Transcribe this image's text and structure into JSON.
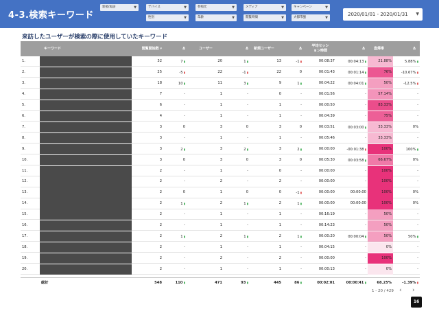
{
  "header": {
    "title": "4-3.検索キーワード",
    "filters": [
      "新規/再訪",
      "デバイス",
      "参照元",
      "メディア",
      "キャンペーン",
      "性別",
      "年齢",
      "閲覧時間",
      "大都市圏"
    ],
    "date_range": "2020/01/01 - 2020/01/31"
  },
  "section_title": "来訪したユーザーが検索の際に使用していたキーワード",
  "table": {
    "headers": {
      "keyword": "キーワード",
      "sessions": "閲覧開始数 ▾",
      "delta1": "Δ",
      "users": "ユーザー",
      "delta2": "Δ",
      "new_users": "新規ユーザー",
      "delta3": "Δ",
      "avg_session_line1": "平均セッシ",
      "avg_session_line2": "ョン時間",
      "delta4": "Δ",
      "bounce": "直帰率",
      "delta5": "Δ"
    },
    "rows": [
      {
        "num": "1.",
        "s": "32",
        "sd": "7",
        "sdir": "up",
        "u": "20",
        "ud": "1",
        "udir": "up",
        "n": "13",
        "nd": "-1",
        "ndir": "down",
        "t": "00:08:37",
        "td": "00:04:13",
        "tdir": "up",
        "b": "21.88%",
        "bd": "5.88%",
        "bdir": "up",
        "shade": 0.25
      },
      {
        "num": "2.",
        "s": "25",
        "sd": "-5",
        "sdir": "down",
        "u": "22",
        "ud": "-1",
        "udir": "down",
        "n": "22",
        "nd": "0",
        "ndir": "",
        "t": "00:01:43",
        "td": "00:01:14",
        "tdir": "up",
        "b": "76%",
        "bd": "-10.67%",
        "bdir": "down",
        "shade": 0.8
      },
      {
        "num": "3.",
        "s": "18",
        "sd": "10",
        "sdir": "up",
        "u": "11",
        "ud": "3",
        "udir": "up",
        "n": "9",
        "nd": "1",
        "ndir": "up",
        "t": "00:04:22",
        "td": "00:04:01",
        "tdir": "up",
        "b": "50%",
        "bd": "-12.5%",
        "bdir": "down",
        "shade": 0.4
      },
      {
        "num": "4.",
        "s": "7",
        "sd": "-",
        "sdir": "",
        "u": "1",
        "ud": "-",
        "udir": "",
        "n": "0",
        "nd": "-",
        "ndir": "",
        "t": "00:01:56",
        "td": "-",
        "tdir": "",
        "b": "57.14%",
        "bd": "-",
        "bdir": "",
        "shade": 0.45
      },
      {
        "num": "5.",
        "s": "6",
        "sd": "-",
        "sdir": "",
        "u": "1",
        "ud": "-",
        "udir": "",
        "n": "1",
        "nd": "-",
        "ndir": "",
        "t": "00:00:50",
        "td": "-",
        "tdir": "",
        "b": "83.33%",
        "bd": "-",
        "bdir": "",
        "shade": 0.85
      },
      {
        "num": "6.",
        "s": "4",
        "sd": "-",
        "sdir": "",
        "u": "1",
        "ud": "-",
        "udir": "",
        "n": "1",
        "nd": "-",
        "ndir": "",
        "t": "00:04:39",
        "td": "-",
        "tdir": "",
        "b": "75%",
        "bd": "-",
        "bdir": "",
        "shade": 0.75
      },
      {
        "num": "7.",
        "s": "3",
        "sd": "0",
        "sdir": "",
        "u": "3",
        "ud": "0",
        "udir": "",
        "n": "3",
        "nd": "0",
        "ndir": "",
        "t": "00:03:51",
        "td": "00:03:00",
        "tdir": "up",
        "b": "33.33%",
        "bd": "0%",
        "bdir": "",
        "shade": 0.25
      },
      {
        "num": "8.",
        "s": "3",
        "sd": "-",
        "sdir": "",
        "u": "1",
        "ud": "-",
        "udir": "",
        "n": "1",
        "nd": "-",
        "ndir": "",
        "t": "00:05:46",
        "td": "-",
        "tdir": "",
        "b": "33.33%",
        "bd": "-",
        "bdir": "",
        "shade": 0.25
      },
      {
        "num": "9.",
        "s": "3",
        "sd": "2",
        "sdir": "up",
        "u": "3",
        "ud": "2",
        "udir": "up",
        "n": "3",
        "nd": "2",
        "ndir": "up",
        "t": "00:00:00",
        "td": "-00:01:38",
        "tdir": "down",
        "b": "100%",
        "bd": "100%",
        "bdir": "up",
        "shade": 1
      },
      {
        "num": "10.",
        "s": "3",
        "sd": "0",
        "sdir": "",
        "u": "3",
        "ud": "0",
        "udir": "",
        "n": "3",
        "nd": "0",
        "ndir": "",
        "t": "00:05:30",
        "td": "00:03:58",
        "tdir": "up",
        "b": "66.67%",
        "bd": "0%",
        "bdir": "",
        "shade": 0.6
      },
      {
        "num": "11.",
        "s": "2",
        "sd": "-",
        "sdir": "",
        "u": "1",
        "ud": "-",
        "udir": "",
        "n": "0",
        "nd": "-",
        "ndir": "",
        "t": "00:00:00",
        "td": "-",
        "tdir": "",
        "b": "100%",
        "bd": "-",
        "bdir": "",
        "shade": 1
      },
      {
        "num": "12.",
        "s": "2",
        "sd": "-",
        "sdir": "",
        "u": "2",
        "ud": "-",
        "udir": "",
        "n": "2",
        "nd": "-",
        "ndir": "",
        "t": "00:00:00",
        "td": "-",
        "tdir": "",
        "b": "100%",
        "bd": "-",
        "bdir": "",
        "shade": 1
      },
      {
        "num": "13.",
        "s": "2",
        "sd": "0",
        "sdir": "",
        "u": "1",
        "ud": "0",
        "udir": "",
        "n": "0",
        "nd": "-1",
        "ndir": "down",
        "t": "00:00:00",
        "td": "00:00:00",
        "tdir": "",
        "b": "100%",
        "bd": "0%",
        "bdir": "",
        "shade": 1
      },
      {
        "num": "14.",
        "s": "2",
        "sd": "1",
        "sdir": "up",
        "u": "2",
        "ud": "1",
        "udir": "up",
        "n": "2",
        "nd": "1",
        "ndir": "up",
        "t": "00:00:00",
        "td": "00:00:00",
        "tdir": "",
        "b": "100%",
        "bd": "0%",
        "bdir": "",
        "shade": 1
      },
      {
        "num": "15.",
        "s": "2",
        "sd": "-",
        "sdir": "",
        "u": "1",
        "ud": "-",
        "udir": "",
        "n": "1",
        "nd": "-",
        "ndir": "",
        "t": "00:16:19",
        "td": "-",
        "tdir": "",
        "b": "50%",
        "bd": "-",
        "bdir": "",
        "shade": 0.4
      },
      {
        "num": "16.",
        "s": "2",
        "sd": "-",
        "sdir": "",
        "u": "1",
        "ud": "-",
        "udir": "",
        "n": "1",
        "nd": "-",
        "ndir": "",
        "t": "00:14:23",
        "td": "-",
        "tdir": "",
        "b": "50%",
        "bd": "-",
        "bdir": "",
        "shade": 0.4
      },
      {
        "num": "17.",
        "s": "2",
        "sd": "1",
        "sdir": "up",
        "u": "2",
        "ud": "1",
        "udir": "up",
        "n": "2",
        "nd": "1",
        "ndir": "up",
        "t": "00:00:20",
        "td": "00:00:04",
        "tdir": "up",
        "b": "50%",
        "bd": "50%",
        "bdir": "up",
        "shade": 0.4
      },
      {
        "num": "18.",
        "s": "2",
        "sd": "-",
        "sdir": "",
        "u": "1",
        "ud": "-",
        "udir": "",
        "n": "1",
        "nd": "-",
        "ndir": "",
        "t": "00:04:15",
        "td": "-",
        "tdir": "",
        "b": "0%",
        "bd": "-",
        "bdir": "",
        "shade": 0
      },
      {
        "num": "19.",
        "s": "2",
        "sd": "-",
        "sdir": "",
        "u": "2",
        "ud": "-",
        "udir": "",
        "n": "2",
        "nd": "-",
        "ndir": "",
        "t": "00:00:00",
        "td": "-",
        "tdir": "",
        "b": "100%",
        "bd": "-",
        "bdir": "",
        "shade": 1
      },
      {
        "num": "20.",
        "s": "2",
        "sd": "-",
        "sdir": "",
        "u": "1",
        "ud": "-",
        "udir": "",
        "n": "1",
        "nd": "-",
        "ndir": "",
        "t": "00:00:13",
        "td": "-",
        "tdir": "",
        "b": "0%",
        "bd": "-",
        "bdir": "",
        "shade": 0
      }
    ],
    "total": {
      "label": "総計",
      "s": "548",
      "sd": "110",
      "sdir": "up",
      "u": "471",
      "ud": "93",
      "udir": "up",
      "n": "445",
      "nd": "86",
      "ndir": "up",
      "t": "00:02:01",
      "td": "00:00:41",
      "tdir": "up",
      "b": "68.25%",
      "bd": "-1.39%",
      "bdir": "down"
    }
  },
  "pagination": {
    "range": "1 - 20 / 429",
    "prev": "‹",
    "next": "›"
  },
  "page_number": "16",
  "colors": {
    "header": "#4472c4",
    "bounce_max": "#e8327a",
    "up": "#21a038",
    "down": "#d9302f"
  }
}
